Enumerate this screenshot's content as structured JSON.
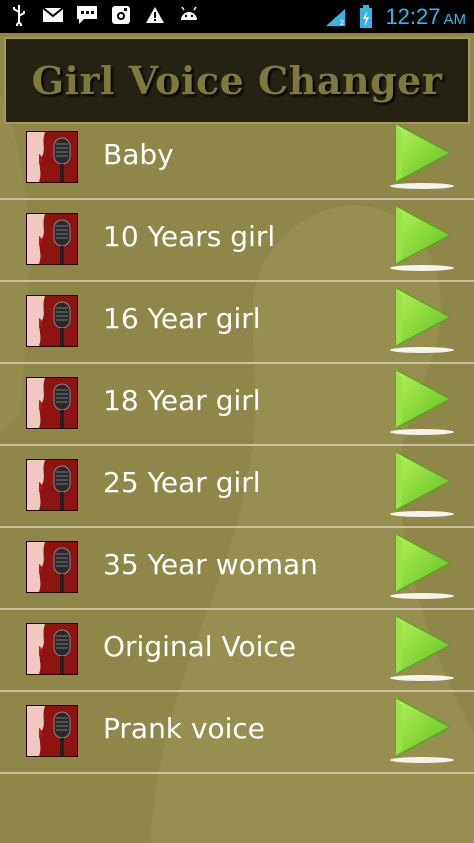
{
  "status_bar": {
    "time": "12:27",
    "ampm": "AM",
    "icons": [
      "usb-icon",
      "email-icon",
      "sms-icon",
      "instagram-icon",
      "warning-icon",
      "android-icon",
      "wifi-icon",
      "signal-icon",
      "battery-icon"
    ]
  },
  "header": {
    "title": "Girl Voice Changer"
  },
  "voices": [
    {
      "label": "Baby"
    },
    {
      "label": "10 Years girl"
    },
    {
      "label": "16 Year girl"
    },
    {
      "label": "18 Year girl"
    },
    {
      "label": "25 Year girl"
    },
    {
      "label": "35 Year woman"
    },
    {
      "label": "Original Voice"
    },
    {
      "label": "Prank voice"
    }
  ],
  "colors": {
    "background": "#8f8748",
    "header_bg": "#232213",
    "title": "#7f7a3a",
    "play_green": "#7ed321",
    "divider": "#c6c2a2"
  }
}
